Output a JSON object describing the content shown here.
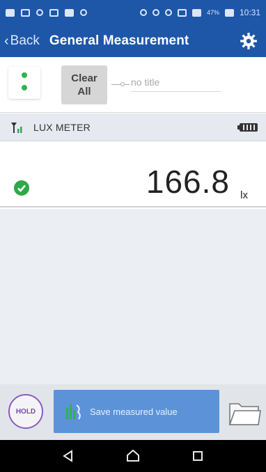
{
  "status_bar": {
    "time": "10:31",
    "battery_percent": "47%",
    "left_icons": [
      "message-icon",
      "screen-icon",
      "sync-icon",
      "app-icon",
      "photo-icon",
      "settings-icon"
    ],
    "right_icons": [
      "bluetooth-icon",
      "key-icon",
      "clock-icon",
      "wifi-icon",
      "signal-icon",
      "battery-icon"
    ]
  },
  "header": {
    "back_label": "Back",
    "title": "General Measurement",
    "accent_color": "#1e56a8"
  },
  "toolbar": {
    "clear_label_line1": "Clear",
    "clear_label_line2": "All",
    "title_placeholder": "no title"
  },
  "device": {
    "name": "LUX METER"
  },
  "measurement": {
    "value": "166.8",
    "unit": "lx",
    "status_color": "#2fa84a"
  },
  "actions": {
    "hold_label": "HOLD",
    "save_label": "Save measured value"
  },
  "nav": {
    "buttons": [
      "back-icon",
      "home-icon",
      "recents-icon"
    ]
  }
}
